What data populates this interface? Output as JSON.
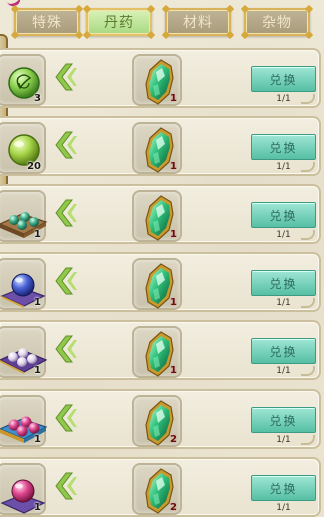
{
  "tabs": [
    {
      "label": "特殊",
      "active": false
    },
    {
      "label": "丹药",
      "active": true
    },
    {
      "label": "材料",
      "active": false
    },
    {
      "label": "杂物",
      "active": false
    }
  ],
  "rows": [
    {
      "item_icon": "green-rune-orb-icon",
      "item_qty": "3",
      "cost_icon": "green-jade-gem-icon",
      "cost_qty": "1",
      "button_label": "兑换",
      "limit": "1/1"
    },
    {
      "item_icon": "green-pill-icon",
      "item_qty": "20",
      "cost_icon": "green-jade-gem-icon",
      "cost_qty": "1",
      "button_label": "兑换",
      "limit": "1/1"
    },
    {
      "item_icon": "teal-pills-on-tray-icon",
      "item_qty": "1",
      "cost_icon": "green-jade-gem-icon",
      "cost_qty": "1",
      "button_label": "兑换",
      "limit": "1/1"
    },
    {
      "item_icon": "blue-orb-on-cushion-icon",
      "item_qty": "1",
      "cost_icon": "green-jade-gem-icon",
      "cost_qty": "1",
      "button_label": "兑换",
      "limit": "1/1"
    },
    {
      "item_icon": "white-pearls-on-cushion-icon",
      "item_qty": "1",
      "cost_icon": "green-jade-gem-icon",
      "cost_qty": "1",
      "button_label": "兑换",
      "limit": "1/1"
    },
    {
      "item_icon": "pink-pills-on-tray-icon",
      "item_qty": "1",
      "cost_icon": "green-jade-gem-icon",
      "cost_qty": "2",
      "button_label": "兑换",
      "limit": "1/1"
    },
    {
      "item_icon": "pink-orb-on-cushion-icon",
      "item_qty": "1",
      "cost_icon": "green-jade-gem-icon",
      "cost_qty": "2",
      "button_label": "兑换",
      "limit": "1/1"
    }
  ],
  "colors": {
    "button": "#55bfa4",
    "active_tab": "#a8d983",
    "tab": "#a89c7a",
    "background": "#ece6d4"
  }
}
